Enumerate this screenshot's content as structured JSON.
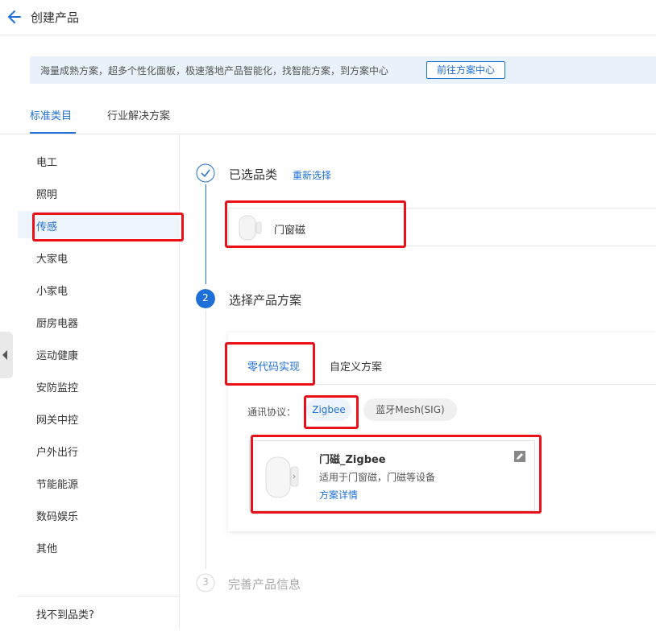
{
  "header": {
    "title": "创建产品"
  },
  "banner": {
    "text": "海量成熟方案，超多个性化面板，极速落地产品智能化，找智能方案，到方案中心",
    "button_label": "前往方案中心"
  },
  "top_tabs": [
    {
      "label": "标准类目",
      "active": true
    },
    {
      "label": "行业解决方案",
      "active": false
    }
  ],
  "sidebar": {
    "items": [
      {
        "label": "电工"
      },
      {
        "label": "照明"
      },
      {
        "label": "传感",
        "active": true
      },
      {
        "label": "大家电"
      },
      {
        "label": "小家电"
      },
      {
        "label": "厨房电器"
      },
      {
        "label": "运动健康"
      },
      {
        "label": "安防监控"
      },
      {
        "label": "网关中控"
      },
      {
        "label": "户外出行"
      },
      {
        "label": "节能能源"
      },
      {
        "label": "数码娱乐"
      },
      {
        "label": "其他"
      }
    ],
    "footer": "找不到品类?"
  },
  "steps": {
    "step1": {
      "title": "已选品类",
      "action": "重新选择",
      "selected": "门窗磁"
    },
    "step2": {
      "number": "2",
      "title": "选择产品方案"
    },
    "step3": {
      "number": "3",
      "title": "完善产品信息"
    }
  },
  "scheme": {
    "tabs": [
      {
        "label": "零代码实现",
        "active": true
      },
      {
        "label": "自定义方案",
        "active": false
      }
    ],
    "protocol_label": "通讯协议：",
    "protocols": [
      {
        "label": "Zigbee",
        "active": true
      },
      {
        "label": "蓝牙Mesh(SIG)",
        "active": false
      }
    ],
    "product": {
      "name": "门磁_Zigbee",
      "desc": "适用于门窗磁，门磁等设备",
      "link": "方案详情"
    }
  },
  "colors": {
    "accent": "#1f6fd8",
    "highlight": "#e8111a",
    "banner_bg": "#e9f2fb"
  }
}
